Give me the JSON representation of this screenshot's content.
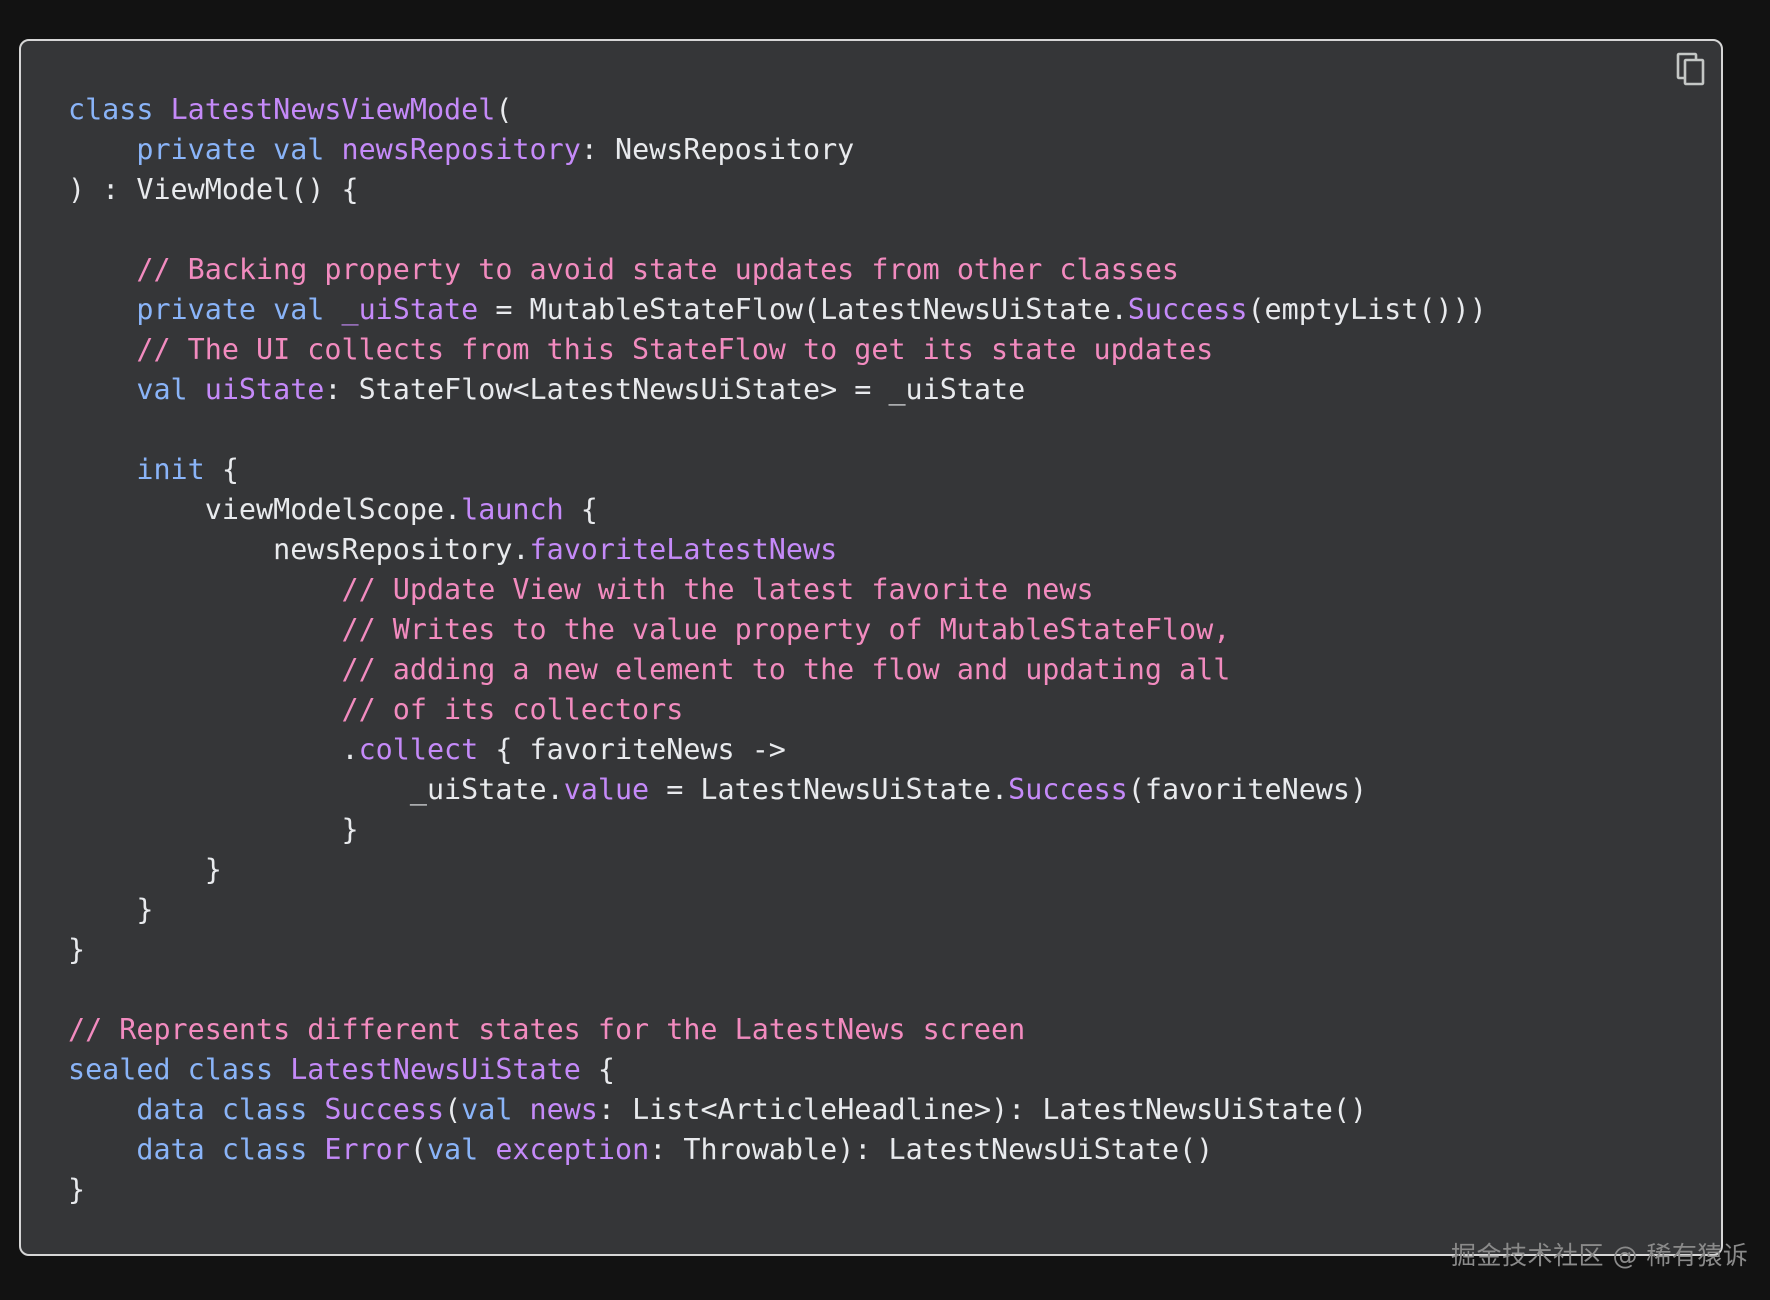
{
  "copy_button": {
    "icon": "copy-icon"
  },
  "code": {
    "language": "kotlin",
    "colors": {
      "keyword": "#8ab4f8",
      "identifier": "#c58af9",
      "comment": "#f28bbf",
      "plain": "#e8eaed",
      "background": "#353638",
      "border": "#d6d6d6"
    },
    "lines": [
      [
        [
          "kw",
          "class "
        ],
        [
          "id",
          "LatestNewsViewModel"
        ],
        [
          "pl",
          "("
        ]
      ],
      [
        [
          "pl",
          "    "
        ],
        [
          "kw",
          "private val "
        ],
        [
          "id",
          "newsRepository"
        ],
        [
          "pl",
          ": NewsRepository"
        ]
      ],
      [
        [
          "pl",
          ") : ViewModel() {"
        ]
      ],
      [],
      [
        [
          "pl",
          "    "
        ],
        [
          "cm",
          "// Backing property to avoid state updates from other classes"
        ]
      ],
      [
        [
          "pl",
          "    "
        ],
        [
          "kw",
          "private val "
        ],
        [
          "id",
          "_uiState"
        ],
        [
          "pl",
          " = MutableStateFlow(LatestNewsUiState."
        ],
        [
          "id",
          "Success"
        ],
        [
          "pl",
          "(emptyList()))"
        ]
      ],
      [
        [
          "pl",
          "    "
        ],
        [
          "cm",
          "// The UI collects from this StateFlow to get its state updates"
        ]
      ],
      [
        [
          "pl",
          "    "
        ],
        [
          "kw",
          "val "
        ],
        [
          "id",
          "uiState"
        ],
        [
          "pl",
          ": StateFlow<LatestNewsUiState> = _uiState"
        ]
      ],
      [],
      [
        [
          "pl",
          "    "
        ],
        [
          "kw",
          "init"
        ],
        [
          "pl",
          " {"
        ]
      ],
      [
        [
          "pl",
          "        viewModelScope."
        ],
        [
          "id",
          "launch"
        ],
        [
          "pl",
          " {"
        ]
      ],
      [
        [
          "pl",
          "            newsRepository."
        ],
        [
          "id",
          "favoriteLatestNews"
        ]
      ],
      [
        [
          "pl",
          "                "
        ],
        [
          "cm",
          "// Update View with the latest favorite news"
        ]
      ],
      [
        [
          "pl",
          "                "
        ],
        [
          "cm",
          "// Writes to the value property of MutableStateFlow,"
        ]
      ],
      [
        [
          "pl",
          "                "
        ],
        [
          "cm",
          "// adding a new element to the flow and updating all"
        ]
      ],
      [
        [
          "pl",
          "                "
        ],
        [
          "cm",
          "// of its collectors"
        ]
      ],
      [
        [
          "pl",
          "                ."
        ],
        [
          "id",
          "collect"
        ],
        [
          "pl",
          " { favoriteNews ->"
        ]
      ],
      [
        [
          "pl",
          "                    _uiState."
        ],
        [
          "id",
          "value"
        ],
        [
          "pl",
          " = LatestNewsUiState."
        ],
        [
          "id",
          "Success"
        ],
        [
          "pl",
          "(favoriteNews)"
        ]
      ],
      [
        [
          "pl",
          "                }"
        ]
      ],
      [
        [
          "pl",
          "        }"
        ]
      ],
      [
        [
          "pl",
          "    }"
        ]
      ],
      [
        [
          "pl",
          "}"
        ]
      ],
      [],
      [
        [
          "cm",
          "// Represents different states for the LatestNews screen"
        ]
      ],
      [
        [
          "kw",
          "sealed class "
        ],
        [
          "id",
          "LatestNewsUiState"
        ],
        [
          "pl",
          " {"
        ]
      ],
      [
        [
          "pl",
          "    "
        ],
        [
          "kw",
          "data class "
        ],
        [
          "id",
          "Success"
        ],
        [
          "pl",
          "("
        ],
        [
          "kw",
          "val "
        ],
        [
          "id",
          "news"
        ],
        [
          "pl",
          ": List<ArticleHeadline>): LatestNewsUiState()"
        ]
      ],
      [
        [
          "pl",
          "    "
        ],
        [
          "kw",
          "data class "
        ],
        [
          "id",
          "Error"
        ],
        [
          "pl",
          "("
        ],
        [
          "kw",
          "val "
        ],
        [
          "id",
          "exception"
        ],
        [
          "pl",
          ": Throwable): LatestNewsUiState()"
        ]
      ],
      [
        [
          "pl",
          "}"
        ]
      ]
    ]
  },
  "watermark": {
    "text": "掘金技术社区 @ 稀有猿诉"
  }
}
